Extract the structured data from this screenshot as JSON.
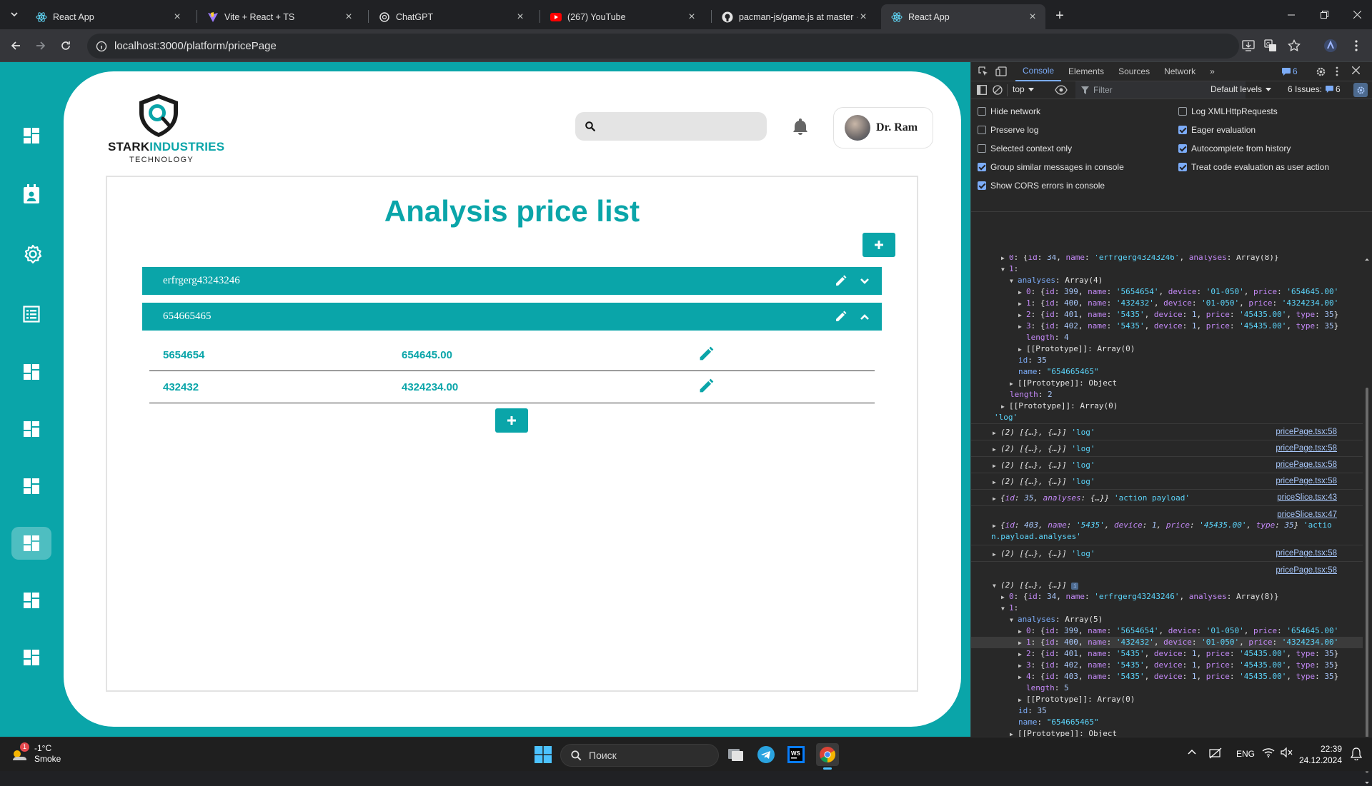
{
  "browser": {
    "tabs": [
      {
        "title": "React App",
        "icon": "react-icon"
      },
      {
        "title": "Vite + React + TS",
        "icon": "vite-icon"
      },
      {
        "title": "ChatGPT",
        "icon": "chatgpt-icon"
      },
      {
        "title": "(267) YouTube",
        "icon": "youtube-icon"
      },
      {
        "title": "pacman-js/game.js at master · s",
        "icon": "github-icon"
      },
      {
        "title": "React App",
        "icon": "react-icon",
        "active": true
      }
    ],
    "url": "localhost:3000/platform/pricePage"
  },
  "app": {
    "brand": {
      "part1": "STARK",
      "part2": "INDUSTRIES",
      "sub": "TECHNOLOGY"
    },
    "search_placeholder": "",
    "user_name": "Dr. Ram",
    "page_title": "Analysis price list",
    "accent": "#0aa5a9",
    "sidebar_icons": [
      "dashboard-icon",
      "calendar-user-icon",
      "settings-icon",
      "list-icon",
      "dashboard-icon",
      "dashboard-icon",
      "dashboard-icon",
      "dashboard-icon",
      "dashboard-icon",
      "dashboard-icon"
    ],
    "active_sidebar_index": 7,
    "categories": [
      {
        "name": "erfrgerg43243246",
        "expanded": false
      },
      {
        "name": "654665465",
        "expanded": true,
        "items": [
          {
            "name": "5654654",
            "price": "654645.00"
          },
          {
            "name": "432432",
            "price": "4324234.00"
          }
        ]
      }
    ]
  },
  "devtools": {
    "tabs": [
      "Console",
      "Elements",
      "Sources",
      "Network"
    ],
    "issues_badge": "6",
    "context": "top",
    "filter_placeholder": "Filter",
    "levels": "Default levels",
    "issues_text": "6 Issues:",
    "issues_count": "6",
    "settings": [
      {
        "label": "Hide network",
        "checked": false
      },
      {
        "label": "Log XMLHttpRequests",
        "checked": false
      },
      {
        "label": "Preserve log",
        "checked": false
      },
      {
        "label": "Eager evaluation",
        "checked": true
      },
      {
        "label": "Selected context only",
        "checked": false
      },
      {
        "label": "Autocomplete from history",
        "checked": true
      },
      {
        "label": "Group similar messages in console",
        "checked": true
      },
      {
        "label": "Treat code evaluation as user action",
        "checked": true
      },
      {
        "label": "Show CORS errors in console",
        "checked": true
      }
    ],
    "source_log": "pricePage.tsx:58",
    "source_slice43": "priceSlice.tsx:43",
    "source_slice47": "priceSlice.tsx:47"
  },
  "taskbar": {
    "temperature": "-1°C",
    "weather": "Smoke",
    "weather_badge": "1",
    "search_label": "Поиск",
    "lang": "ENG",
    "time": "22:39",
    "date": "24.12.2024"
  }
}
